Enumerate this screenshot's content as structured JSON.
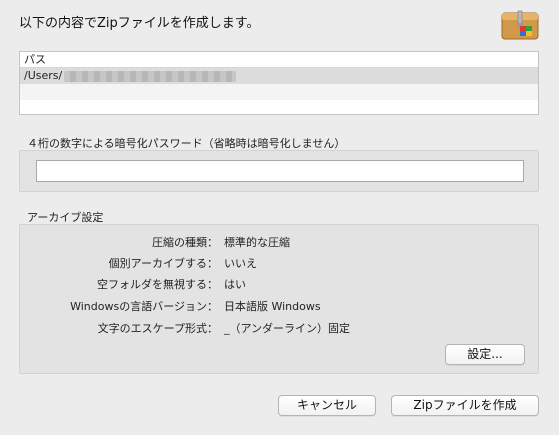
{
  "dialog": {
    "heading": "以下の内容でZipファイルを作成します。"
  },
  "path_table": {
    "header": "パス",
    "rows": [
      "/Users/"
    ]
  },
  "password": {
    "label": "４桁の数字による暗号化パスワード（省略時は暗号化しません）",
    "value": ""
  },
  "archive": {
    "label": "アーカイブ設定",
    "settings": [
      {
        "key": "圧縮の種類：",
        "value": "標準的な圧縮"
      },
      {
        "key": "個別アーカイブする：",
        "value": "いいえ"
      },
      {
        "key": "空フォルダを無視する：",
        "value": "はい"
      },
      {
        "key": "Windowsの言語バージョン：",
        "value": "日本語版 Windows"
      },
      {
        "key": "文字のエスケープ形式：",
        "value": "_（アンダーライン）固定"
      }
    ],
    "settings_button": "設定..."
  },
  "buttons": {
    "cancel": "キャンセル",
    "create": "Zipファイルを作成"
  },
  "colors": {
    "window_bg": "#ececec",
    "panel_bg": "#e3e3e3",
    "selected_row": "#dcdcdc"
  },
  "icons": {
    "app": "zip-archive-icon"
  }
}
